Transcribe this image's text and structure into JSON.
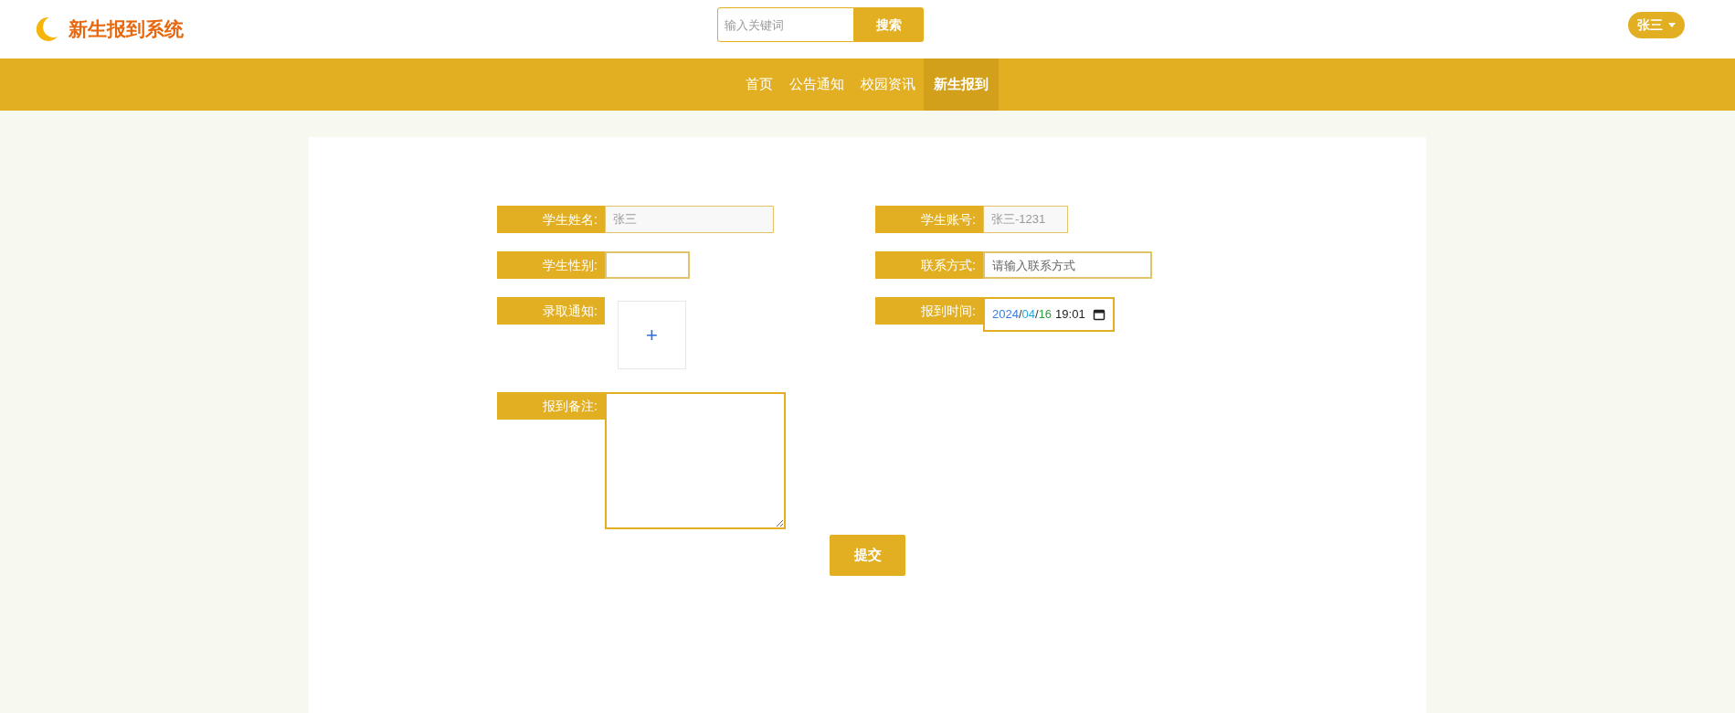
{
  "header": {
    "title": "新生报到系统",
    "search": {
      "placeholder": "输入关键词",
      "button": "搜索"
    },
    "user": "张三"
  },
  "nav": [
    {
      "label": "首页",
      "selected": false
    },
    {
      "label": "公告通知",
      "selected": false
    },
    {
      "label": "校园资讯",
      "selected": false
    },
    {
      "label": "新生报到",
      "selected": true
    }
  ],
  "form": {
    "rows": [
      [
        {
          "kind": "readonly",
          "label": "学生姓名:",
          "value": "张三"
        },
        {
          "kind": "readonly",
          "label": "学生账号:",
          "value": "张三-1231"
        }
      ],
      [
        {
          "kind": "input",
          "label": "学生性别:"
        },
        {
          "kind": "input",
          "label": "联系方式:",
          "placeholder": "请输入联系方式"
        }
      ],
      [
        {
          "kind": "upload",
          "label": "录取通知:",
          "button": "+"
        },
        {
          "kind": "datetime",
          "label": "报到时间:",
          "separator": "/",
          "segments": [
            {
              "text": "2024",
              "color": "#3b7ddd"
            },
            {
              "text": "04",
              "color": "#29a8e0"
            },
            {
              "text": "16",
              "color": "#2e9e3e"
            }
          ],
          "time": "19:01"
        }
      ],
      [
        {
          "kind": "textarea",
          "label": "报到备注:"
        }
      ]
    ],
    "submit": "提交"
  }
}
